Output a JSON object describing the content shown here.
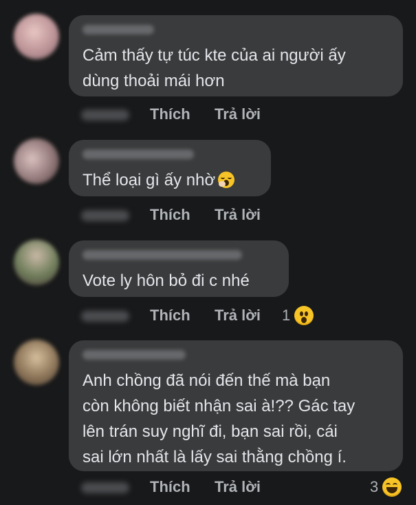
{
  "comments": [
    {
      "text": "Cảm thấy tự túc kte của ai người ấy\ndùng thoải mái hơn",
      "avatar_color": "#c9a3a6",
      "like_label": "Thích",
      "reply_label": "Trả lời"
    },
    {
      "text": "Thể loại gì ấy nhờ",
      "avatar_color": "#9e8b8a",
      "like_label": "Thích",
      "reply_label": "Trả lời"
    },
    {
      "text": "Vote ly hôn bỏ đi c nhé",
      "avatar_color": "#7c8a6f",
      "like_label": "Thích",
      "reply_label": "Trả lời",
      "reaction_count": "1",
      "reaction_icon": "wow-emoji-icon"
    },
    {
      "text": "Anh chồng đã nói đến thế mà bạn\ncòn không biết nhận sai à!?? Gác tay\nlên trán suy nghĩ đi, bạn sai rồi, cái\nsai lớn nhất là lấy sai thằng chồng í.",
      "avatar_color": "#a38b68",
      "like_label": "Thích",
      "reply_label": "Trả lời",
      "reaction_count": "3",
      "reaction_icon": "haha-emoji-icon"
    }
  ],
  "colors": {
    "background": "#18191a",
    "bubble": "#3a3b3c",
    "text": "#e4e6eb",
    "muted": "#b0b3b8",
    "emoji": "#f7c427"
  }
}
